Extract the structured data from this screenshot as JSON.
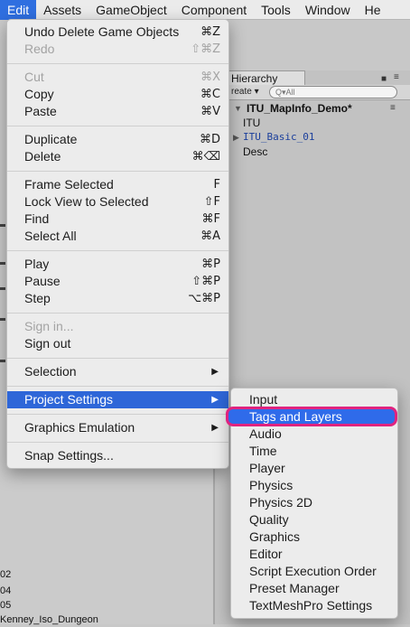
{
  "menubar": {
    "items": [
      "Edit",
      "Assets",
      "GameObject",
      "Component",
      "Tools",
      "Window",
      "He"
    ]
  },
  "edit_menu": {
    "items": [
      {
        "label": "Undo Delete Game Objects",
        "shortcut": "⌘Z",
        "disabled": false
      },
      {
        "label": "Redo",
        "shortcut": "⇧⌘Z",
        "disabled": true
      },
      {
        "label": "Cut",
        "shortcut": "⌘X",
        "disabled": true
      },
      {
        "label": "Copy",
        "shortcut": "⌘C",
        "disabled": false
      },
      {
        "label": "Paste",
        "shortcut": "⌘V",
        "disabled": false
      },
      {
        "label": "Duplicate",
        "shortcut": "⌘D",
        "disabled": false
      },
      {
        "label": "Delete",
        "shortcut": "⌘⌫",
        "disabled": false
      },
      {
        "label": "Frame Selected",
        "shortcut": "F",
        "disabled": false
      },
      {
        "label": "Lock View to Selected",
        "shortcut": "⇧F",
        "disabled": false
      },
      {
        "label": "Find",
        "shortcut": "⌘F",
        "disabled": false
      },
      {
        "label": "Select All",
        "shortcut": "⌘A",
        "disabled": false
      },
      {
        "label": "Play",
        "shortcut": "⌘P",
        "disabled": false
      },
      {
        "label": "Pause",
        "shortcut": "⇧⌘P",
        "disabled": false
      },
      {
        "label": "Step",
        "shortcut": "⌥⌘P",
        "disabled": false
      },
      {
        "label": "Sign in...",
        "shortcut": "",
        "disabled": true
      },
      {
        "label": "Sign out",
        "shortcut": "",
        "disabled": false
      },
      {
        "label": "Selection",
        "shortcut": "",
        "disabled": false
      },
      {
        "label": "Project Settings",
        "shortcut": "",
        "disabled": false
      },
      {
        "label": "Graphics Emulation",
        "shortcut": "",
        "disabled": false
      },
      {
        "label": "Snap Settings...",
        "shortcut": "",
        "disabled": false
      }
    ]
  },
  "project_settings_submenu": {
    "items": [
      "Input",
      "Tags and Layers",
      "Audio",
      "Time",
      "Player",
      "Physics",
      "Physics 2D",
      "Quality",
      "Graphics",
      "Editor",
      "Script Execution Order",
      "Preset Manager",
      "TextMeshPro Settings"
    ],
    "selected": "Tags and Layers"
  },
  "hierarchy": {
    "tab_label": "Hierarchy",
    "create_label": "reate ▾",
    "search_placeholder": "Q▾All",
    "scene_name": "ITU_MapInfo_Demo*",
    "children": [
      "ITU",
      "ITU_Basic_01",
      "Desc"
    ]
  },
  "project_list": {
    "rows": [
      "02",
      "04",
      "05",
      "Kenney_Iso_Dungeon"
    ]
  },
  "colors": {
    "highlight": "#2e66d8",
    "annotation": "#e0237f",
    "prefab_text": "#1b3f9c"
  },
  "icons": {
    "submenu_arrow": "▶",
    "tree_expand": "▶",
    "lock": "🔒",
    "kebab": "≡"
  }
}
